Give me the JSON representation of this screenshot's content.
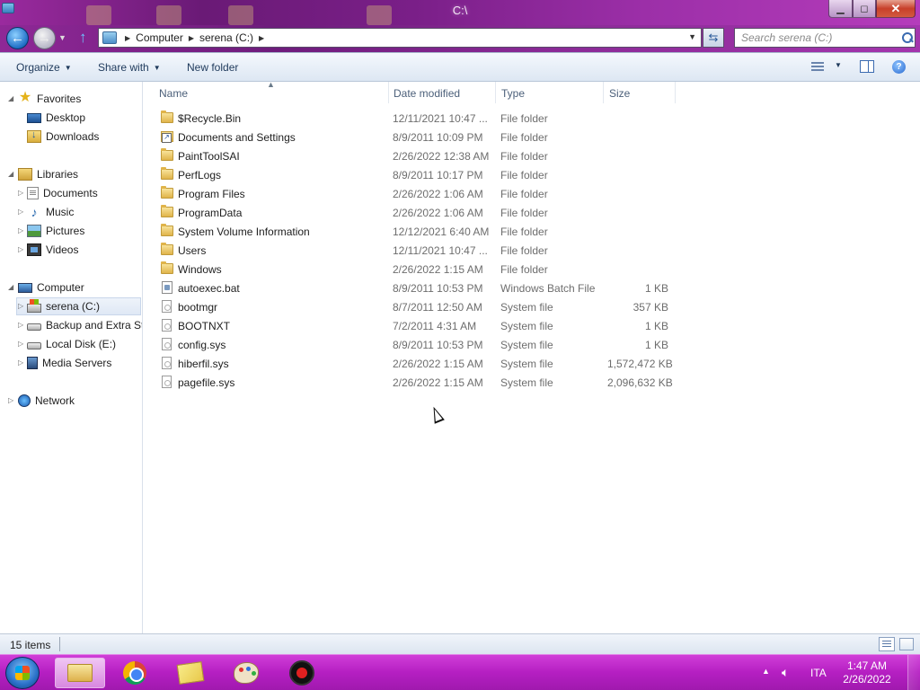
{
  "window": {
    "title": "C:\\",
    "controls": {
      "minimize": "▁",
      "maximize": "◻",
      "close": "✕"
    }
  },
  "nav": {
    "breadcrumb": [
      "Computer",
      "serena (C:)"
    ],
    "search_placeholder": "Search serena (C:)",
    "back_icon": "back-arrow-icon",
    "forward_icon": "forward-arrow-icon"
  },
  "toolbar": {
    "organize": "Organize",
    "share_with": "Share with",
    "new_folder": "New folder"
  },
  "sidebar": {
    "favorites": {
      "label": "Favorites",
      "items": [
        {
          "label": "Desktop",
          "icon": "desktop-icon"
        },
        {
          "label": "Downloads",
          "icon": "downloads-icon"
        }
      ]
    },
    "libraries": {
      "label": "Libraries",
      "items": [
        {
          "label": "Documents",
          "icon": "documents-icon"
        },
        {
          "label": "Music",
          "icon": "music-icon"
        },
        {
          "label": "Pictures",
          "icon": "pictures-icon"
        },
        {
          "label": "Videos",
          "icon": "videos-icon"
        }
      ]
    },
    "computer": {
      "label": "Computer",
      "items": [
        {
          "label": "serena (C:)",
          "icon": "drive-c-icon",
          "selected": true
        },
        {
          "label": "Backup and Extra Sto",
          "icon": "drive-icon"
        },
        {
          "label": "Local Disk (E:)",
          "icon": "drive-icon"
        },
        {
          "label": "Media Servers",
          "icon": "media-server-icon"
        }
      ]
    },
    "network": {
      "label": "Network"
    }
  },
  "columns": {
    "name": "Name",
    "date_modified": "Date modified",
    "type": "Type",
    "size": "Size"
  },
  "files": [
    {
      "name": "$Recycle.Bin",
      "date": "12/11/2021 10:47 ...",
      "type": "File folder",
      "size": "",
      "icon": "folder"
    },
    {
      "name": "Documents and Settings",
      "date": "8/9/2011 10:09 PM",
      "type": "File folder",
      "size": "",
      "icon": "shortcut"
    },
    {
      "name": "PaintToolSAI",
      "date": "2/26/2022 12:38 AM",
      "type": "File folder",
      "size": "",
      "icon": "folder"
    },
    {
      "name": "PerfLogs",
      "date": "8/9/2011 10:17 PM",
      "type": "File folder",
      "size": "",
      "icon": "folder"
    },
    {
      "name": "Program Files",
      "date": "2/26/2022 1:06 AM",
      "type": "File folder",
      "size": "",
      "icon": "folder"
    },
    {
      "name": "ProgramData",
      "date": "2/26/2022 1:06 AM",
      "type": "File folder",
      "size": "",
      "icon": "folder"
    },
    {
      "name": "System Volume Information",
      "date": "12/12/2021 6:40 AM",
      "type": "File folder",
      "size": "",
      "icon": "folder"
    },
    {
      "name": "Users",
      "date": "12/11/2021 10:47 ...",
      "type": "File folder",
      "size": "",
      "icon": "folder"
    },
    {
      "name": "Windows",
      "date": "2/26/2022 1:15 AM",
      "type": "File folder",
      "size": "",
      "icon": "folder"
    },
    {
      "name": "autoexec.bat",
      "date": "8/9/2011 10:53 PM",
      "type": "Windows Batch File",
      "size": "1 KB",
      "icon": "batch"
    },
    {
      "name": "bootmgr",
      "date": "8/7/2011 12:50 AM",
      "type": "System file",
      "size": "357 KB",
      "icon": "file"
    },
    {
      "name": "BOOTNXT",
      "date": "7/2/2011 4:31 AM",
      "type": "System file",
      "size": "1 KB",
      "icon": "file"
    },
    {
      "name": "config.sys",
      "date": "8/9/2011 10:53 PM",
      "type": "System file",
      "size": "1 KB",
      "icon": "file"
    },
    {
      "name": "hiberfil.sys",
      "date": "2/26/2022 1:15 AM",
      "type": "System file",
      "size": "1,572,472 KB",
      "icon": "file"
    },
    {
      "name": "pagefile.sys",
      "date": "2/26/2022 1:15 AM",
      "type": "System file",
      "size": "2,096,632 KB",
      "icon": "file"
    }
  ],
  "status": {
    "count": "15 items"
  },
  "taskbar": {
    "apps": [
      "windows-explorer",
      "google-chrome",
      "sticky-notes",
      "paint-tool",
      "screen-recorder"
    ],
    "language": "ITA",
    "time": "1:47 AM",
    "date": "2/26/2022"
  },
  "colors": {
    "title_bar": "#8a2494",
    "taskbar": "#b51fc2",
    "column_header_text": "#4c607a",
    "secondary_text": "#6d6d6d"
  }
}
